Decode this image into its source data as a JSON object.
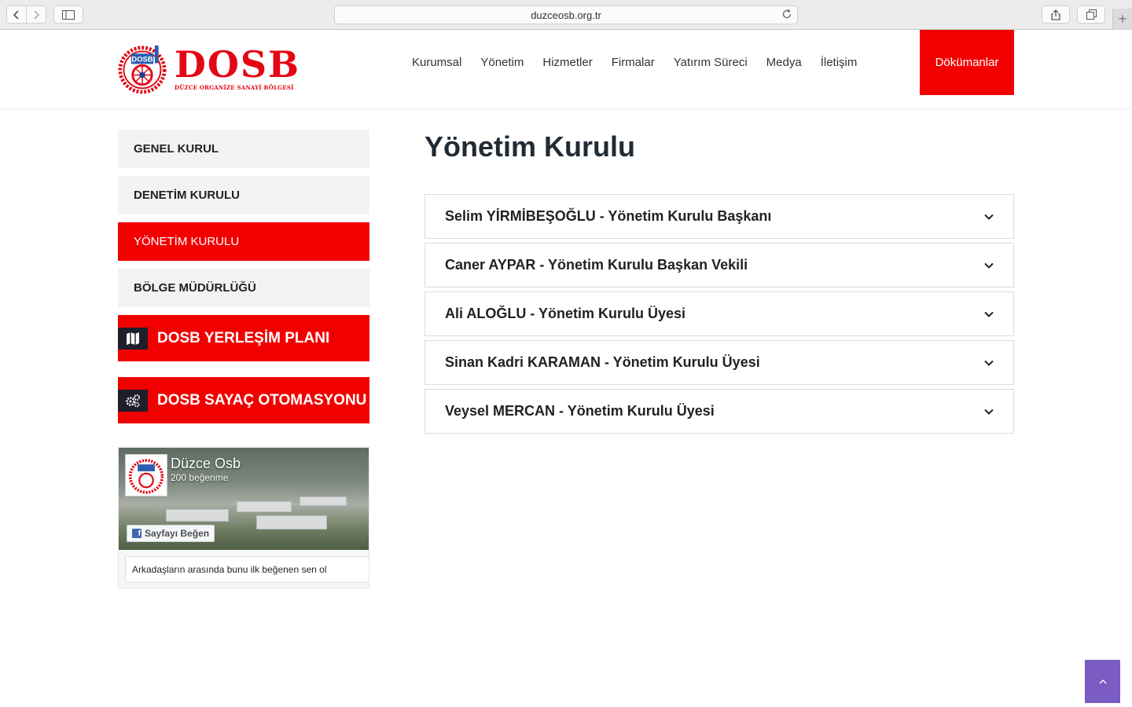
{
  "browser": {
    "url": "duzceosb.org.tr"
  },
  "logo": {
    "word": "DOSB",
    "subtitle": "DÜZCE ORGANİZE SANAYİ BÖLGESİ",
    "mark_text": "DOSB",
    "color": "#e30613"
  },
  "nav": {
    "items": [
      "Kurumsal",
      "Yönetim",
      "Hizmetler",
      "Firmalar",
      "Yatırım Süreci",
      "Medya",
      "İletişim"
    ],
    "docs_label": "Dökümanlar"
  },
  "sidebar": {
    "items": [
      {
        "label": "GENEL KURUL",
        "active": false
      },
      {
        "label": "DENETİM KURULU",
        "active": false
      },
      {
        "label": "YÖNETİM KURULU",
        "active": true
      },
      {
        "label": "BÖLGE MÜDÜRLÜĞÜ",
        "active": false
      }
    ],
    "promos": [
      {
        "label": "DOSB YERLEŞİM PLANI",
        "icon": "map-icon"
      },
      {
        "label": "DOSB SAYAÇ OTOMASYONU",
        "icon": "gears-icon"
      }
    ]
  },
  "facebook": {
    "page_name": "Düzce Osb",
    "likes": "200 beğenme",
    "like_button": "Sayfayı Beğen",
    "footer": "Arkadaşların arasında bunu ilk beğenen sen ol"
  },
  "main": {
    "title": "Yönetim Kurulu",
    "members": [
      "Selim YİRMİBEŞOĞLU - Yönetim Kurulu Başkanı",
      "Caner AYPAR - Yönetim Kurulu Başkan Vekili",
      "Ali ALOĞLU - Yönetim Kurulu Üyesi",
      "Sinan Kadri KARAMAN - Yönetim Kurulu Üyesi",
      "Veysel MERCAN - Yönetim Kurulu Üyesi"
    ]
  },
  "colors": {
    "accent": "#f20000",
    "scroll_top": "#7a5cc2"
  }
}
